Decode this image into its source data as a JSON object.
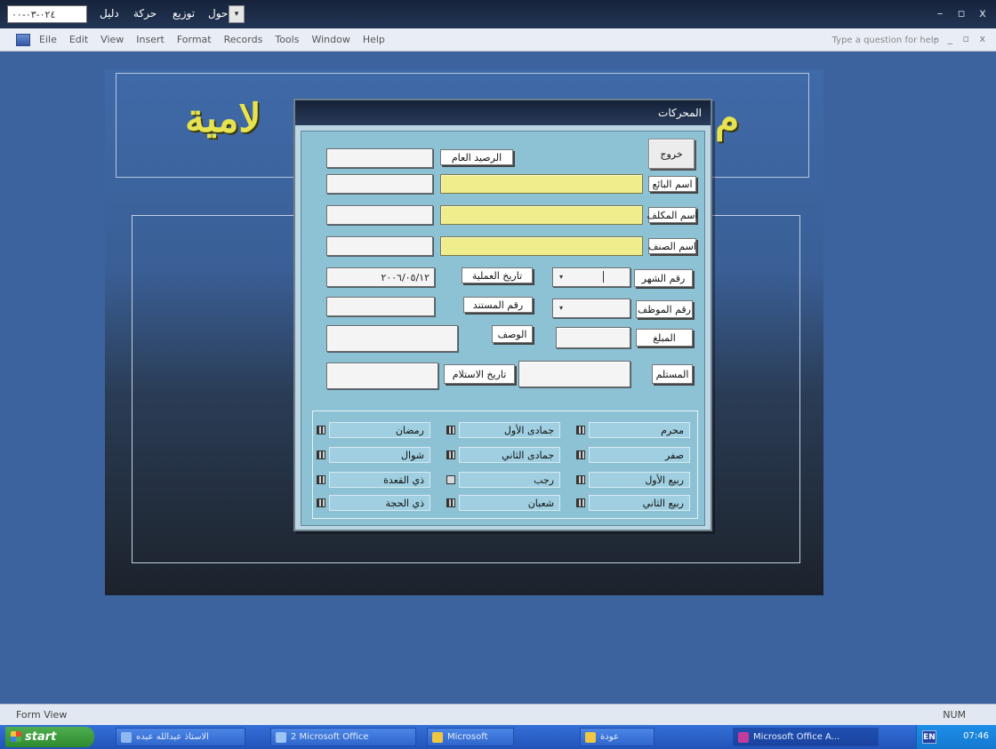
{
  "titlebar": {
    "date_field": "٠٢٤-٠٣-٠٠",
    "menu_text_1": "دليل",
    "menu_text_2": "حركة",
    "menu_text_3": "توزيع",
    "menu_text_4": "حول",
    "dropdown_glyph": "▾",
    "close": "x",
    "restore": "▫",
    "minimize": "–"
  },
  "menubar": {
    "items": [
      "Eile",
      "Edit",
      "View",
      "Insert",
      "Format",
      "Records",
      "Tools",
      "Window",
      "Help"
    ],
    "help_placeholder": "Type a question for help",
    "window_controls": "- _ ▫ x"
  },
  "background_form": {
    "title_right": "م",
    "title_left": "لامية"
  },
  "dialog": {
    "title": "المحركات",
    "exit_button": "خروج",
    "general_balance_label": "الرصيد العام",
    "buyer_name_label": "اسم البائع",
    "recipient_name_label": "اسم المكلف",
    "item_name_label": "اسم الصنف",
    "month_number_label": "رقم الشهر",
    "month_number_value": "",
    "operation_date_label": "تاريخ العملية",
    "operation_date_value": "٢٠٠٦/٠٥/١٢",
    "employee_number_label": "رقم الموظف",
    "stamp_number_label": "رقم المستند",
    "amount_label": "المبلغ",
    "description_label": "الوصف",
    "receiver_label": "المستلم",
    "receipt_date_label": "تاريخ الاستلام",
    "dropdown_glyph": "▾",
    "months": [
      {
        "name": "محرم",
        "checked": true
      },
      {
        "name": "جمادى الأول",
        "checked": true
      },
      {
        "name": "رمضان",
        "checked": true
      },
      {
        "name": "صفر",
        "checked": true
      },
      {
        "name": "جمادى الثاني",
        "checked": true
      },
      {
        "name": "شوال",
        "checked": true
      },
      {
        "name": "ربيع الأول",
        "checked": true
      },
      {
        "name": "رجب",
        "checked": false
      },
      {
        "name": "ذي القعدة",
        "checked": true
      },
      {
        "name": "ربيع الثاني",
        "checked": true
      },
      {
        "name": "شعبان",
        "checked": true
      },
      {
        "name": "ذي الحجة",
        "checked": true
      }
    ]
  },
  "statusbar": {
    "left": "Form View",
    "right": "NUM"
  },
  "taskbar": {
    "start": "start",
    "buttons": [
      {
        "label": "الاستاذ عبدالله عبده",
        "color": "#8fb8f0"
      },
      {
        "label": "2 Microsoft Office",
        "color": "#9cc4f4"
      },
      {
        "label": "Microsoft",
        "color": "#f1c640"
      },
      {
        "label": "عودة",
        "color": "#f1c640"
      },
      {
        "label": "Microsoft Office A...",
        "color": "#c43b9b"
      }
    ],
    "lang": "EN",
    "clock": "07:46"
  }
}
